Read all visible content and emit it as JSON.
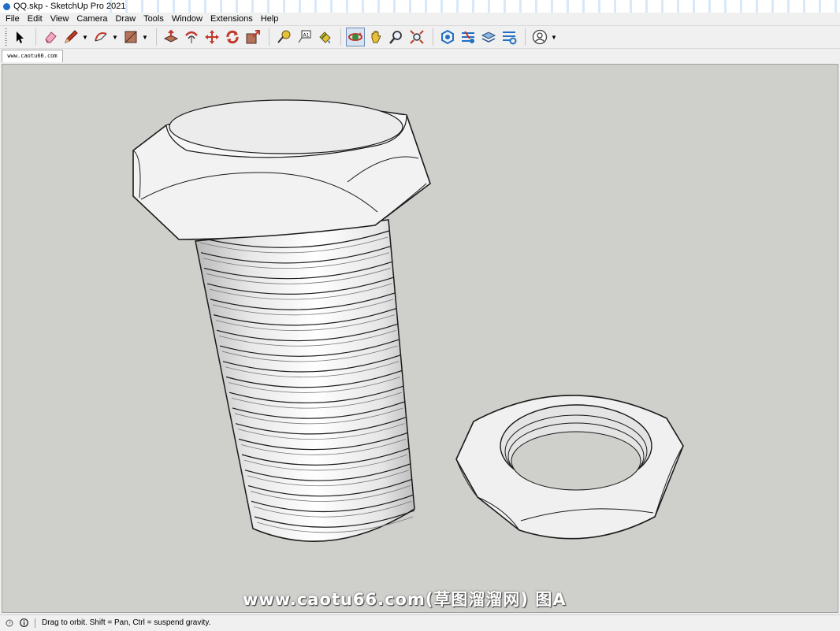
{
  "window": {
    "title": "QQ.skp - SketchUp Pro 2021",
    "app_icon": "sketchup-icon"
  },
  "menu": [
    "File",
    "Edit",
    "View",
    "Camera",
    "Draw",
    "Tools",
    "Window",
    "Extensions",
    "Help"
  ],
  "toolbar": {
    "tools": [
      {
        "name": "select-icon"
      },
      {
        "name": "eraser-icon"
      },
      {
        "name": "pencil-line-icon"
      },
      {
        "name": "arc-icon"
      },
      {
        "name": "rectangle-icon"
      },
      {
        "name": "push-pull-icon"
      },
      {
        "name": "offset-icon"
      },
      {
        "name": "move-icon"
      },
      {
        "name": "rotate-icon"
      },
      {
        "name": "scale-icon"
      },
      {
        "name": "tape-measure-icon"
      },
      {
        "name": "text-icon"
      },
      {
        "name": "paint-bucket-icon"
      },
      {
        "name": "orbit-icon",
        "active": true
      },
      {
        "name": "pan-icon"
      },
      {
        "name": "zoom-icon"
      },
      {
        "name": "zoom-extents-icon"
      },
      {
        "name": "3d-warehouse-icon"
      },
      {
        "name": "extension-warehouse-icon"
      },
      {
        "name": "layout-icon"
      },
      {
        "name": "extension-manager-icon"
      },
      {
        "name": "account-icon"
      }
    ]
  },
  "tab": {
    "label": "www.caotu66.com"
  },
  "watermark": "www.caotu66.com(草图溜溜网) 图A",
  "status": {
    "text": "Drag to orbit. Shift = Pan, Ctrl = suspend gravity."
  },
  "colors": {
    "viewport_bg": "#cfcfcb",
    "model_face": "#f4f4f4",
    "edge": "#1a1a1a"
  }
}
